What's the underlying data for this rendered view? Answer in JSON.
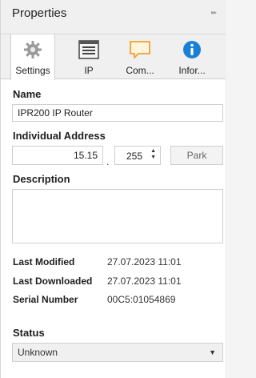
{
  "panel": {
    "title": "Properties",
    "collapse_glyph": "▸▸"
  },
  "tabs": [
    {
      "label": "Settings",
      "icon": "gear-icon",
      "active": true
    },
    {
      "label": "IP",
      "icon": "ip-icon",
      "active": false
    },
    {
      "label": "Com...",
      "icon": "comment-icon",
      "active": false
    },
    {
      "label": "Infor...",
      "icon": "info-icon",
      "active": false
    }
  ],
  "name": {
    "label": "Name",
    "value": "IPR200 IP Router"
  },
  "address": {
    "label": "Individual Address",
    "area_line": "15.15",
    "separator": ".",
    "device": "255",
    "park_label": "Park"
  },
  "description": {
    "label": "Description",
    "value": ""
  },
  "info": {
    "last_modified_label": "Last Modified",
    "last_modified_value": "27.07.2023 11:01",
    "last_downloaded_label": "Last Downloaded",
    "last_downloaded_value": "27.07.2023 11:01",
    "serial_label": "Serial Number",
    "serial_value": "00C5:01054869"
  },
  "status": {
    "label": "Status",
    "value": "Unknown"
  },
  "colors": {
    "info_blue": "#1a7fd6",
    "comment_orange": "#f0a030"
  }
}
